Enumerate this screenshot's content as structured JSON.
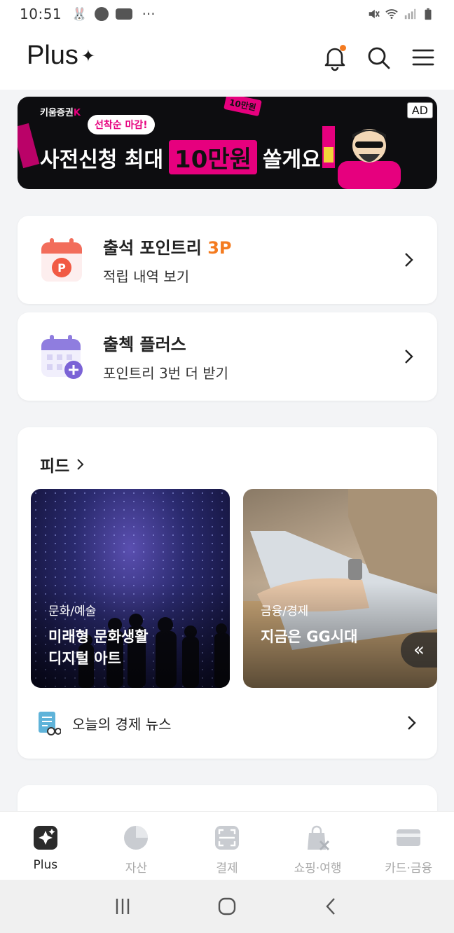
{
  "status_bar": {
    "time": "10:51",
    "more": "···"
  },
  "header": {
    "title": "Plus",
    "star": "✦"
  },
  "banner": {
    "brand": "키움증권",
    "brand_k": "K",
    "pill": "선착순 마감!",
    "headline_pre": "사전신청 최대",
    "headline_highlight": "10만원",
    "headline_post": "쏠게요",
    "tag": "10만원",
    "ad_label": "AD",
    "colors": {
      "bg": "#0d0d10",
      "accent": "#e6007e"
    }
  },
  "attendance": {
    "title": "출석 포인트리",
    "points": "3P",
    "subtitle": "적립 내역 보기",
    "icon": "point-calendar-icon"
  },
  "check_plus": {
    "title": "출첵 플러스",
    "subtitle": "포인트리 3번 더 받기",
    "icon": "calendar-plus-icon"
  },
  "feed": {
    "title": "피드",
    "items": [
      {
        "category": "문화/예술",
        "headline": "미래형 문화생활\n디지털 아트",
        "line1": "미래형 문화생활",
        "line2": "디지털 아트"
      },
      {
        "category": "금융/경제",
        "headline": "지금은 GG시대"
      }
    ],
    "scroll_icon": "«",
    "news_label": "오늘의 경제 뉴스"
  },
  "bottom_nav": [
    {
      "label": "Plus",
      "icon": "plus-sparkle-icon",
      "active": true
    },
    {
      "label": "자산",
      "icon": "pie-chart-icon"
    },
    {
      "label": "결제",
      "icon": "scan-icon"
    },
    {
      "label": "쇼핑·여행",
      "icon": "shopping-bag-icon"
    },
    {
      "label": "카드·금융",
      "icon": "card-icon"
    }
  ],
  "accent_color": "#f47b20"
}
